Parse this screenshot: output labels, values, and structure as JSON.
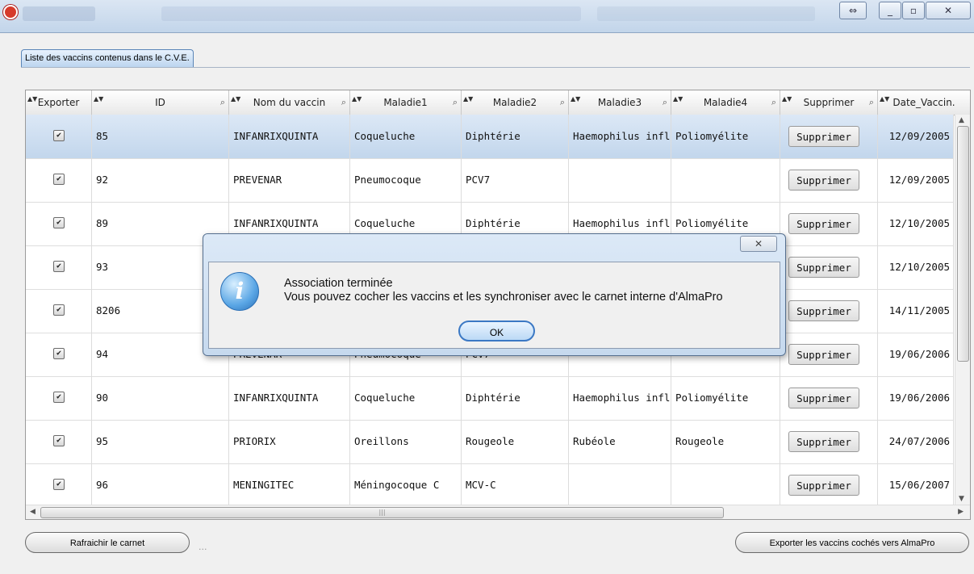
{
  "tab": {
    "label": "Liste des vaccins contenus dans le C.V.E."
  },
  "window": {
    "close": "✕",
    "restore": "▫",
    "minimize": "_",
    "swap": "⇔"
  },
  "table": {
    "columns": [
      "Exporter",
      "ID",
      "Nom du vaccin",
      "Maladie1",
      "Maladie2",
      "Maladie3",
      "Maladie4",
      "Supprimer",
      "Date_Vaccin."
    ],
    "rows": [
      {
        "exporter": true,
        "id": "85",
        "nom": "INFANRIXQUINTA",
        "m1": "Coqueluche",
        "m2": "Diphtérie",
        "m3": "Haemophilus influ",
        "m4": "Poliomyélite",
        "supprimer": "Supprimer",
        "date": "12/09/2005"
      },
      {
        "exporter": true,
        "id": "92",
        "nom": "PREVENAR",
        "m1": "Pneumocoque",
        "m2": "PCV7",
        "m3": "",
        "m4": "",
        "supprimer": "Supprimer",
        "date": "12/09/2005"
      },
      {
        "exporter": true,
        "id": "89",
        "nom": "INFANRIXQUINTA",
        "m1": "Coqueluche",
        "m2": "Diphtérie",
        "m3": "Haemophilus influ",
        "m4": "Poliomyélite",
        "supprimer": "Supprimer",
        "date": "12/10/2005"
      },
      {
        "exporter": true,
        "id": "93",
        "nom": "",
        "m1": "",
        "m2": "",
        "m3": "",
        "m4": "",
        "supprimer": "Supprimer",
        "date": "12/10/2005"
      },
      {
        "exporter": true,
        "id": "8206",
        "nom": "",
        "m1": "",
        "m2": "",
        "m3": "",
        "m4": "",
        "supprimer": "Supprimer",
        "date": "14/11/2005"
      },
      {
        "exporter": true,
        "id": "94",
        "nom": "PREVENAR",
        "m1": "Pneumocoque",
        "m2": "PCV7",
        "m3": "",
        "m4": "",
        "supprimer": "Supprimer",
        "date": "19/06/2006"
      },
      {
        "exporter": true,
        "id": "90",
        "nom": "INFANRIXQUINTA",
        "m1": "Coqueluche",
        "m2": "Diphtérie",
        "m3": "Haemophilus influ",
        "m4": "Poliomyélite",
        "supprimer": "Supprimer",
        "date": "19/06/2006"
      },
      {
        "exporter": true,
        "id": "95",
        "nom": "PRIORIX",
        "m1": "Oreillons",
        "m2": "Rougeole",
        "m3": "Rubéole",
        "m4": "Rougeole",
        "supprimer": "Supprimer",
        "date": "24/07/2006"
      },
      {
        "exporter": true,
        "id": "96",
        "nom": "MENINGITEC",
        "m1": "Méningocoque C",
        "m2": "MCV-C",
        "m3": "",
        "m4": "",
        "supprimer": "Supprimer",
        "date": "15/06/2007"
      }
    ]
  },
  "footer": {
    "refresh_label": "Rafraichir le carnet",
    "dots": "...",
    "export_label": "Exporter les vaccins cochés vers AlmaPro"
  },
  "dialog": {
    "line1": "Association terminée",
    "line2": "Vous pouvez cocher les vaccins et les synchroniser avec le carnet interne d'AlmaPro",
    "ok_label": "OK",
    "close": "✕"
  }
}
